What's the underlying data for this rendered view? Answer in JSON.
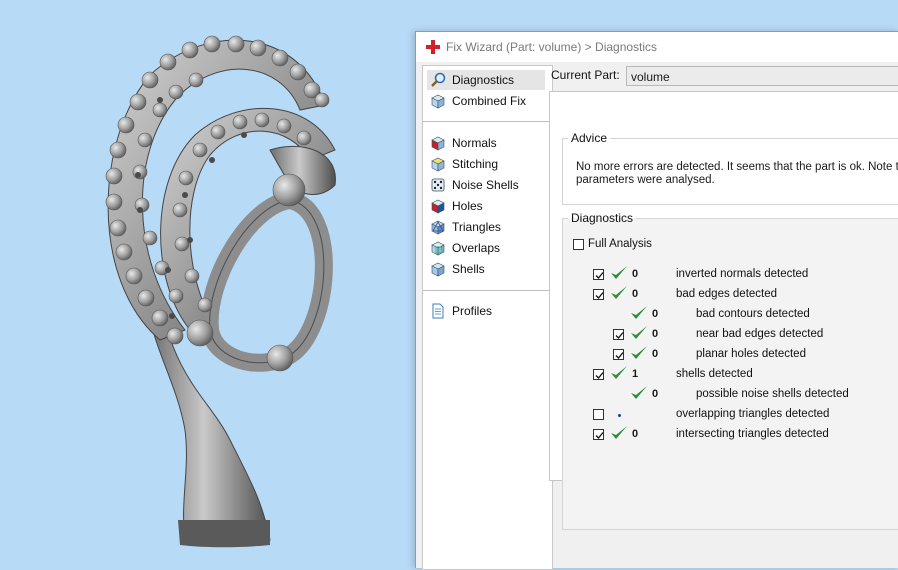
{
  "window": {
    "title": "Fix Wizard (Part: volume) > Diagnostics"
  },
  "nav": {
    "top_items": [
      {
        "label": "Diagnostics",
        "icon": "magnifier-icon",
        "selected": true
      },
      {
        "label": "Combined Fix",
        "icon": "cube-wireframe-icon"
      }
    ],
    "fix_items": [
      {
        "label": "Normals",
        "icon": "normals-cube-icon"
      },
      {
        "label": "Stitching",
        "icon": "stitching-cube-icon"
      },
      {
        "label": "Noise Shells",
        "icon": "noise-dice-icon"
      },
      {
        "label": "Holes",
        "icon": "holes-cube-icon"
      },
      {
        "label": "Triangles",
        "icon": "triangles-cube-icon"
      },
      {
        "label": "Overlaps",
        "icon": "overlaps-cube-icon"
      },
      {
        "label": "Shells",
        "icon": "shells-cube-icon"
      }
    ],
    "bottom_items": [
      {
        "label": "Profiles",
        "icon": "document-icon"
      }
    ]
  },
  "current_part": {
    "label": "Current Part:",
    "value": "volume"
  },
  "advice": {
    "legend": "Advice",
    "text": "No more errors are detected. It seems that the part is ok. Note th\nparameters were analysed."
  },
  "diagnostics": {
    "legend": "Diagnostics",
    "full_analysis_label": "Full Analysis",
    "rows": [
      {
        "checkbox": true,
        "checked": true,
        "ok": true,
        "count": "0",
        "label": "inverted normals detected",
        "indent": 0
      },
      {
        "checkbox": true,
        "checked": true,
        "ok": true,
        "count": "0",
        "label": "bad edges detected",
        "indent": 0
      },
      {
        "checkbox": false,
        "checked": false,
        "ok": true,
        "count": "0",
        "label": "bad contours detected",
        "indent": 1
      },
      {
        "checkbox": true,
        "checked": true,
        "ok": true,
        "count": "0",
        "label": "near bad edges detected",
        "indent": 1
      },
      {
        "checkbox": true,
        "checked": true,
        "ok": true,
        "count": "0",
        "label": "planar holes detected",
        "indent": 1
      },
      {
        "checkbox": true,
        "checked": true,
        "ok": true,
        "count": "1",
        "label": "shells detected",
        "indent": 0
      },
      {
        "checkbox": false,
        "checked": false,
        "ok": true,
        "count": "0",
        "label": "possible noise shells detected",
        "indent": 1
      },
      {
        "checkbox": true,
        "checked": false,
        "ok": false,
        "count": "",
        "label": "overlapping triangles detected",
        "indent": 0
      },
      {
        "checkbox": true,
        "checked": true,
        "ok": true,
        "count": "0",
        "label": "intersecting triangles detected",
        "indent": 0
      }
    ]
  },
  "colors": {
    "viewport_bg": "#b7daf7",
    "ok_green": "#2e8b3a",
    "selection": "#e5e5e5"
  }
}
